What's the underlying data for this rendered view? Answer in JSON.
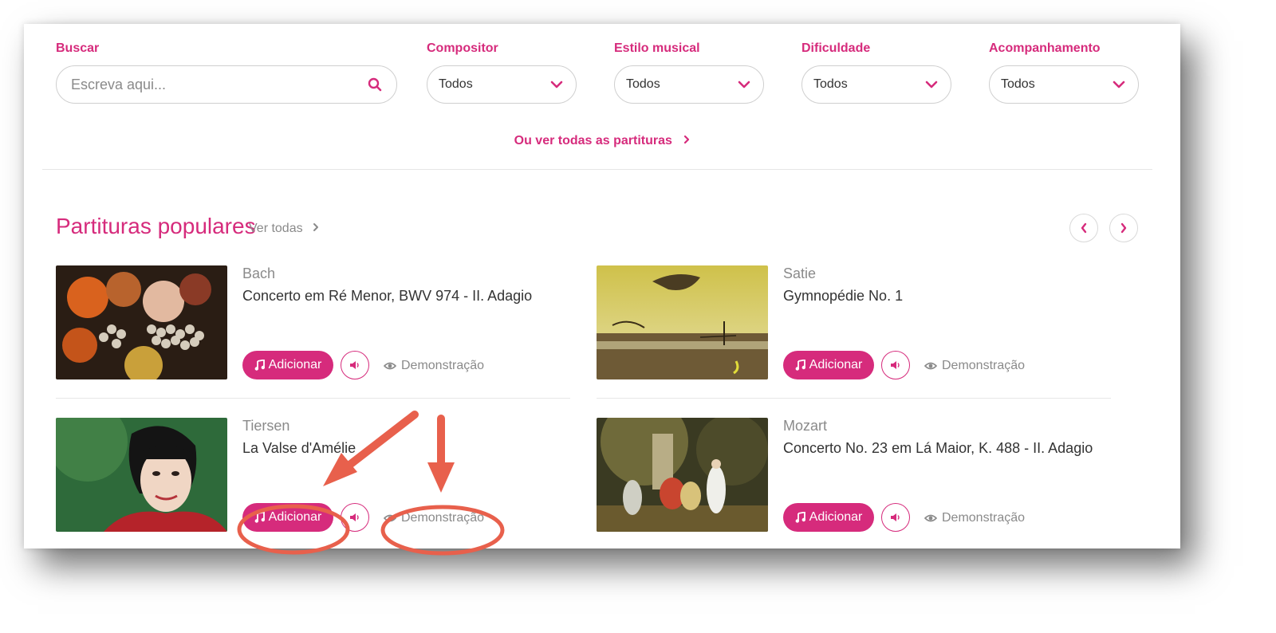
{
  "filters": {
    "search": {
      "label": "Buscar",
      "placeholder": "Escreva aqui..."
    },
    "composer": {
      "label": "Compositor",
      "value": "Todos"
    },
    "style": {
      "label": "Estilo musical",
      "value": "Todos"
    },
    "difficulty": {
      "label": "Dificuldade",
      "value": "Todos"
    },
    "accompaniment": {
      "label": "Acompanhamento",
      "value": "Todos"
    }
  },
  "see_all_scores": "Ou ver todas as partituras",
  "popular": {
    "title": "Partituras populares",
    "see_all": "Ver todas",
    "cards": [
      {
        "composer": "Bach",
        "title": "Concerto em Ré Menor, BWV 974 - II. Adagio",
        "add_label": "Adicionar",
        "demo_label": "Demonstração"
      },
      {
        "composer": "Satie",
        "title": "Gymnopédie No. 1",
        "add_label": "Adicionar",
        "demo_label": "Demonstração"
      },
      {
        "composer": "Tiersen",
        "title": "La Valse d'Amélie",
        "add_label": "Adicionar",
        "demo_label": "Demonstração"
      },
      {
        "composer": "Mozart",
        "title": "Concerto No. 23 em Lá Maior, K. 488 - II. Adagio",
        "add_label": "Adicionar",
        "demo_label": "Demonstração"
      }
    ]
  },
  "colors": {
    "accent": "#d62b7c",
    "muted": "#8a8a8a",
    "annotation": "#e8604c"
  }
}
